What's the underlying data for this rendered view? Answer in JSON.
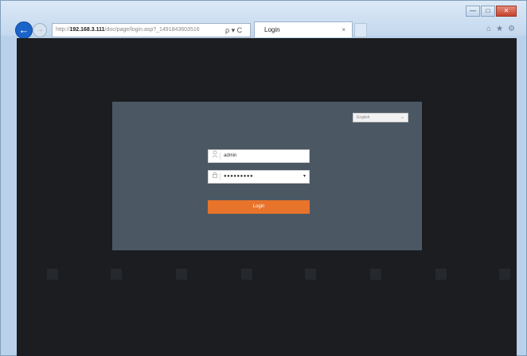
{
  "browser": {
    "back_glyph": "←",
    "forward_glyph": "→",
    "address_prefix": "http://",
    "address_host": "192.168.3.111",
    "address_path": "/doc/page/login.asp?_1491843603516",
    "address_icons": "ρ ▾ C",
    "tab_title": "Login",
    "tab_close": "×",
    "window_buttons": {
      "minimize": "—",
      "maximize": "□",
      "close": "✕"
    },
    "tool_icons": {
      "home": "⌂",
      "favorites": "★",
      "settings": "⚙"
    }
  },
  "login": {
    "language": "English",
    "language_caret": "⌄",
    "username_icon": "person-icon",
    "username_value": "admin",
    "password_icon": "lock-icon",
    "password_value": "●●●●●●●●●",
    "password_caret": "▾",
    "login_button": "Login"
  },
  "colors": {
    "panel": "#4b5864",
    "background": "#1c1d20",
    "login_button": "#e8732a"
  }
}
